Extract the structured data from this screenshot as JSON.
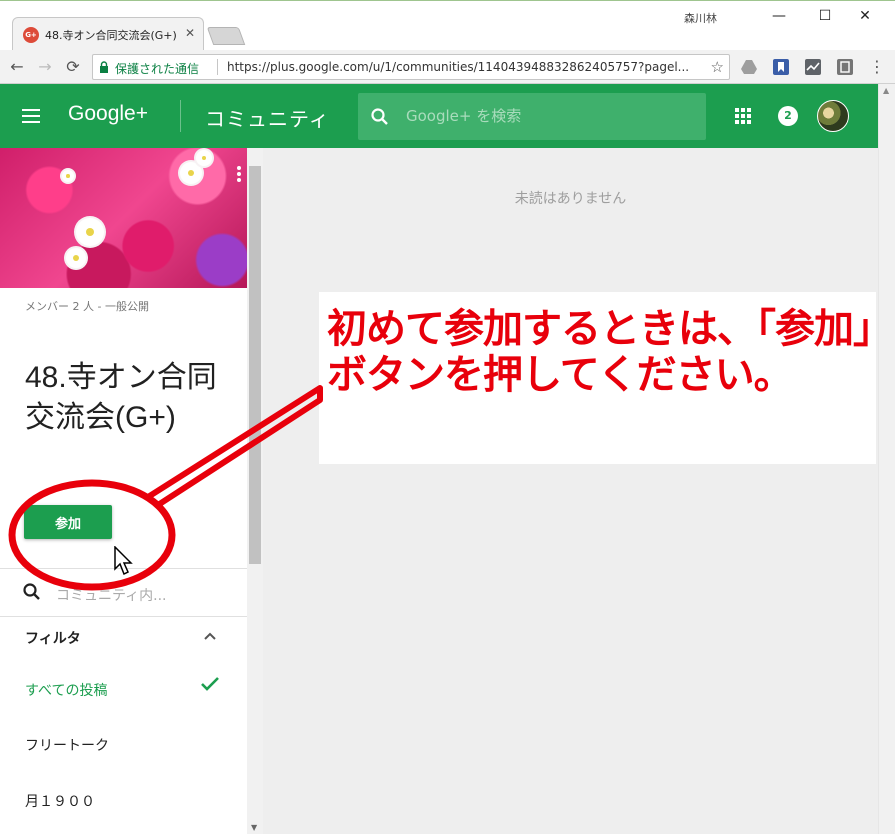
{
  "window": {
    "tab_title": "48.寺オン合同交流会(G+)",
    "tab_close": "✕",
    "user_name": "森川林",
    "minimize": "—",
    "maximize": "☐",
    "close": "✕"
  },
  "toolbar": {
    "back": "←",
    "forward": "→",
    "reload": "⟳",
    "secure_label": "保護された通信",
    "url": "https://plus.google.com/u/1/communities/114043948832862405757?pagel...",
    "star": "☆"
  },
  "header": {
    "brand": "Google+",
    "section": "コミュニティ",
    "search_placeholder": "Google+ を検索",
    "notification_count": "2"
  },
  "community": {
    "member_info": "メンバー 2 人 - 一般公開",
    "name": "48.寺オン合同交流会(G+)",
    "join_label": "参加",
    "search_placeholder": "コミュニティ内..."
  },
  "filter": {
    "title": "フィルタ",
    "items": [
      {
        "label": "すべての投稿",
        "active": true
      },
      {
        "label": "フリートーク",
        "active": false
      },
      {
        "label": "月１９００",
        "active": false
      }
    ]
  },
  "main": {
    "empty_message": "未読はありません"
  },
  "annotation": {
    "text": "初めて参加するときは、「参加」ボタンを押してください。",
    "color": "#e8000b"
  },
  "colors": {
    "brand_green": "#1c9e4f",
    "annotation_red": "#e8000b"
  }
}
